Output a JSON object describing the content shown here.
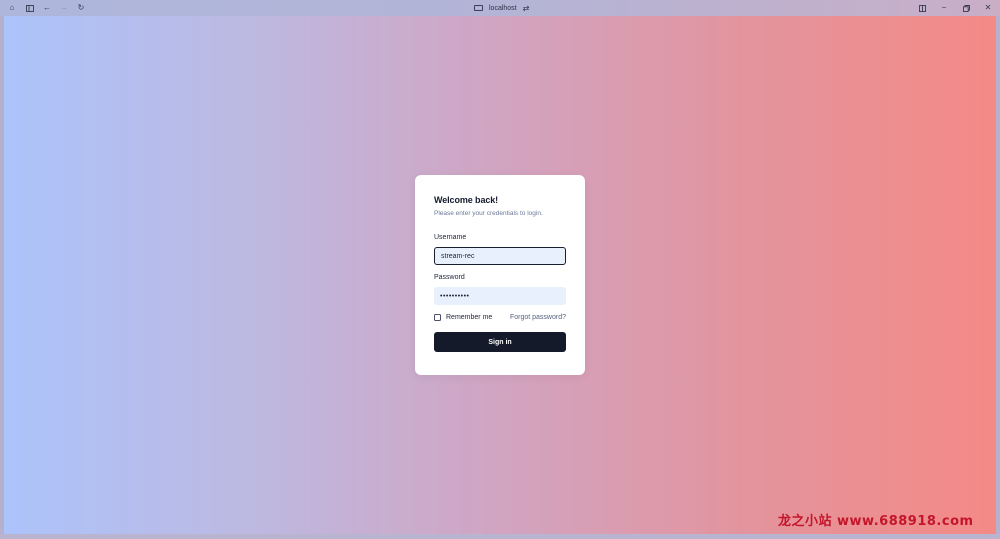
{
  "browser": {
    "address": "localhost",
    "icons": {
      "home": "home-icon",
      "sidebar": "sidebar-icon",
      "back": "back-arrow-icon",
      "forward": "forward-arrow-icon",
      "reload": "reload-icon",
      "site_info": "site-info-icon",
      "switch": "switch-icon",
      "split": "split-view-icon",
      "minimize": "minimize-icon",
      "restore": "restore-icon",
      "close": "close-icon"
    }
  },
  "login": {
    "title": "Welcome back!",
    "subtitle": "Please enter your credentials to login.",
    "username_label": "Username",
    "username_value": "stream-rec",
    "password_label": "Password",
    "password_value": "••••••••••",
    "remember_label": "Remember me",
    "remember_checked": false,
    "forgot_label": "Forgot password?",
    "submit_label": "Sign in"
  },
  "colors": {
    "gradient_start": "#acc3fb",
    "gradient_end": "#f48a86",
    "button_bg": "#141a2a",
    "input_bg": "#e8f0fe"
  },
  "watermark": {
    "text": "龙之小站 www.688918.com"
  }
}
